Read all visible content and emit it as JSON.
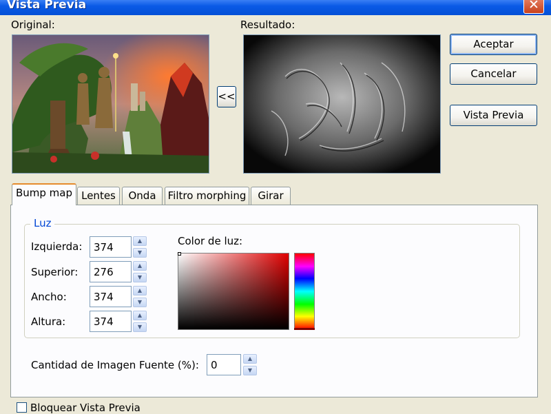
{
  "window": {
    "title": "Vista Previa",
    "close_glyph": "✕"
  },
  "original": {
    "label": "Original:"
  },
  "result": {
    "label": "Resultado:"
  },
  "copy_button": {
    "label": "<<"
  },
  "buttons": {
    "accept": "Aceptar",
    "cancel": "Cancelar",
    "preview": "Vista Previa"
  },
  "tabs": [
    {
      "label": "Bump map",
      "active": true
    },
    {
      "label": "Lentes"
    },
    {
      "label": "Onda"
    },
    {
      "label": "Filtro morphing"
    },
    {
      "label": "Girar"
    }
  ],
  "light": {
    "group_title": "Luz",
    "fields": [
      {
        "label": "Izquierda:",
        "value": "374"
      },
      {
        "label": "Superior:",
        "value": "276"
      },
      {
        "label": "Ancho:",
        "value": "374"
      },
      {
        "label": "Altura:",
        "value": "374"
      }
    ],
    "color_label": "Color de luz:",
    "selected_hue_color": "#ff0000"
  },
  "source_amount": {
    "label": "Cantidad de Imagen Fuente (%):",
    "value": "0"
  },
  "lock_preview": {
    "label": "Bloquear Vista Previa",
    "checked": false
  },
  "colors": {
    "titlebar": "#0a5ae6",
    "dialog_bg": "#ece9d8",
    "group_title": "#0046d5",
    "tab_highlight": "#e68b2c"
  }
}
